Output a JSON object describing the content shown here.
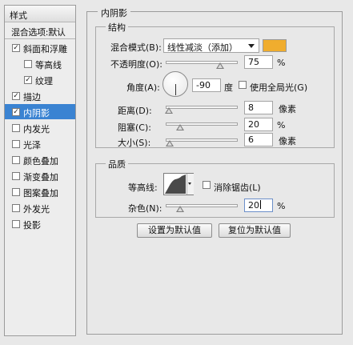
{
  "sidebar": {
    "header": "样式",
    "blend_default": "混合选项:默认",
    "items": [
      {
        "label": "斜面和浮雕",
        "checked": true
      },
      {
        "label": "等高线",
        "checked": false
      },
      {
        "label": "纹理",
        "checked": true
      },
      {
        "label": "描边",
        "checked": true
      },
      {
        "label": "内阴影",
        "checked": true
      },
      {
        "label": "内发光",
        "checked": false
      },
      {
        "label": "光泽",
        "checked": false
      },
      {
        "label": "颜色叠加",
        "checked": false
      },
      {
        "label": "渐变叠加",
        "checked": false
      },
      {
        "label": "图案叠加",
        "checked": false
      },
      {
        "label": "外发光",
        "checked": false
      },
      {
        "label": "投影",
        "checked": false
      }
    ]
  },
  "panel": {
    "title": "内阴影",
    "structure": {
      "title": "结构",
      "blend_mode_label": "混合模式(B):",
      "blend_mode_value": "线性减淡（添加）",
      "color": "#f0ad2e",
      "opacity_label": "不透明度(O):",
      "opacity_value": "75",
      "opacity_unit": "%",
      "angle_label": "角度(A):",
      "angle_value": "-90",
      "angle_unit": "度",
      "global_light_label": "使用全局光(G)",
      "global_light_checked": false,
      "distance_label": "距离(D):",
      "distance_value": "8",
      "distance_unit": "像素",
      "choke_label": "阻塞(C):",
      "choke_value": "20",
      "choke_unit": "%",
      "size_label": "大小(S):",
      "size_value": "6",
      "size_unit": "像素"
    },
    "quality": {
      "title": "品质",
      "contour_label": "等高线:",
      "antialias_label": "消除锯齿(L)",
      "antialias_checked": false,
      "noise_label": "杂色(N):",
      "noise_value": "20",
      "noise_unit": "%"
    },
    "buttons": {
      "make_default": "设置为默认值",
      "reset_default": "复位为默认值"
    }
  }
}
